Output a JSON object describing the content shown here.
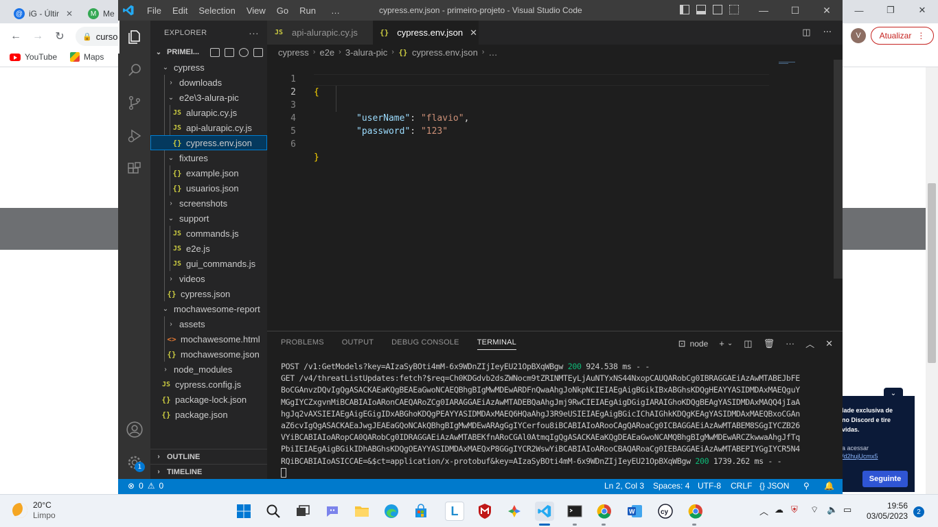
{
  "browser": {
    "tabs": [
      {
        "label": "iG - Últir"
      },
      {
        "label": "Me"
      }
    ],
    "url_partial": "curso",
    "bookmarks": [
      {
        "label": "YouTube",
        "icon": "youtube-icon"
      },
      {
        "label": "Maps",
        "icon": "maps-icon"
      }
    ],
    "profile_initial": "V",
    "update_button": "Atualizar",
    "discord_card": {
      "line1": "lade exclusiva de",
      "line2": "no Discord e tire",
      "line3": "vidas.",
      "line4": "a acessar",
      "link": "/d2hujUcmx5",
      "button": "Seguinte"
    }
  },
  "vscode": {
    "menu": [
      "File",
      "Edit",
      "Selection",
      "View",
      "Go",
      "Run",
      "…"
    ],
    "window_title": "cypress.env.json - primeiro-projeto - Visual Studio Code",
    "explorer_title": "EXPLORER",
    "explorer_more": "···",
    "project_name": "PRIMEI...",
    "tree": [
      {
        "label": "cypress"
      },
      {
        "label": "downloads"
      },
      {
        "label": "e2e\\3-alura-pic"
      },
      {
        "label": "alurapic.cy.js"
      },
      {
        "label": "api-alurapic.cy.js"
      },
      {
        "label": "cypress.env.json"
      },
      {
        "label": "fixtures"
      },
      {
        "label": "example.json"
      },
      {
        "label": "usuarios.json"
      },
      {
        "label": "screenshots"
      },
      {
        "label": "support"
      },
      {
        "label": "commands.js"
      },
      {
        "label": "e2e.js"
      },
      {
        "label": "gui_commands.js"
      },
      {
        "label": "videos"
      },
      {
        "label": "cypress.json"
      },
      {
        "label": "mochawesome-report"
      },
      {
        "label": "assets"
      },
      {
        "label": "mochawesome.html"
      },
      {
        "label": "mochawesome.json"
      },
      {
        "label": "node_modules"
      },
      {
        "label": "cypress.config.js"
      },
      {
        "label": "package-lock.json"
      },
      {
        "label": "package.json"
      }
    ],
    "outline_label": "OUTLINE",
    "timeline_label": "TIMELINE",
    "tabs": [
      {
        "label": "api-alurapic.cy.js"
      },
      {
        "label": "cypress.env.json"
      }
    ],
    "breadcrumb": [
      "cypress",
      "e2e",
      "3-alura-pic",
      "cypress.env.json",
      "…"
    ],
    "code": {
      "line_numbers": [
        "1",
        "2",
        "3",
        "4",
        "5",
        "6"
      ],
      "open_brace": "{",
      "close_brace": "}",
      "key1": "\"userName\"",
      "val1": "\"flavio\"",
      "key2": "\"password\"",
      "val2": "\"123\"",
      "colon": ": ",
      "comma": ","
    },
    "panel_tabs": [
      "PROBLEMS",
      "OUTPUT",
      "DEBUG CONSOLE",
      "TERMINAL"
    ],
    "terminal_shell": "node",
    "terminal": {
      "line1_prefix": "POST /v1:GetModels?key=AIzaSyBOti4mM-6x9WDnZIjIeyEU21OpBXqWBgw ",
      "line1_status": "200",
      "line1_suffix": " 924.538 ms - -",
      "line2": "GET /v4/threatListUpdates:fetch?$req=Ch0KDGdvb2dsZWNocm9tZRINMTEyLjAuNTYxNS44NxopCAUQARobCg0IBRAGGAEiAzAwMTABEJbFE",
      "line3": "BoCGAnvzDQvIgQgASACKAEaKQgBEAEaGwoNCAEQBhgBIgMwMDEwARDFnQwaAhgJoNkpNCIEIAEgAigBGikIBxABGhsKDQgHEAYYASIDMDAxMAEQguY",
      "line4": "MGgIYCZxgvnMiBCABIAIoARonCAEQARoZCg0IARAGGAEiAzAwMTADEBQaAhgJmj9RwCIEIAEgAigDGigIARAIGhoKDQgBEAgYASIDMDAxMAQQ4jIaA",
      "line5": "hgJq2vAXSIEIAEgAigEGigIDxABGhoKDQgPEAYYASIDMDAxMAEQ6HQaAhgJ3R9eUSIEIAEgAigBGicIChAIGhkKDQgKEAgYASIDMDAxMAEQBxoCGAn",
      "line6": "aZ6cvIgQgASACKAEaJwgJEAEaGQoNCAkQBhgBIgMwMDEwARAgGgIYCerfou8iBCABIAIoARooCAgQARoaCg0ICBAGGAEiAzAwMTABEM8SGgIYCZB26",
      "line7": "VYiBCABIAIoARopCA0QARobCg0IDRAGGAEiAzAwMTABEKfnARoCGAl0AtmqIgQgASACKAEaKQgDEAEaGwoNCAMQBhgBIgMwMDEwARCZkwwaAhgJfTq",
      "line8": "PbiIEIAEgAigBGikIDhABGhsKDQgOEAYYASIDMDAxMAEQxP8GGgIYCR2WswYiBCABIAIoARooCBAQARoaCg0IEBAGGAEiAzAwMTABEPIYGgIYCR5N4",
      "line9_prefix": "RQiBCABIAIoASICCAE=&$ct=application/x-protobuf&key=AIzaSyBOti4mM-6x9WDnZIjIeyEU21OpBXqWBgw ",
      "line9_status": "200",
      "line9_suffix": " 1739.262 ms - -"
    },
    "status": {
      "errors": "0",
      "warnings": "0",
      "position": "Ln 2, Col 3",
      "spaces": "Spaces: 4",
      "encoding": "UTF-8",
      "eol": "CRLF",
      "language": "JSON",
      "notifications_badge": "1"
    }
  },
  "taskbar": {
    "temperature": "20°C",
    "condition": "Limpo",
    "time": "19:56",
    "date": "03/05/2023",
    "notification_count": "2"
  },
  "colors": {
    "vscode_statusbar": "#007acc",
    "vscode_editor_bg": "#1e1e1e",
    "json_brace": "#ffd700",
    "json_key": "#9cdcfe",
    "json_string": "#ce9178",
    "terminal_status_ok": "#0dbc79"
  }
}
